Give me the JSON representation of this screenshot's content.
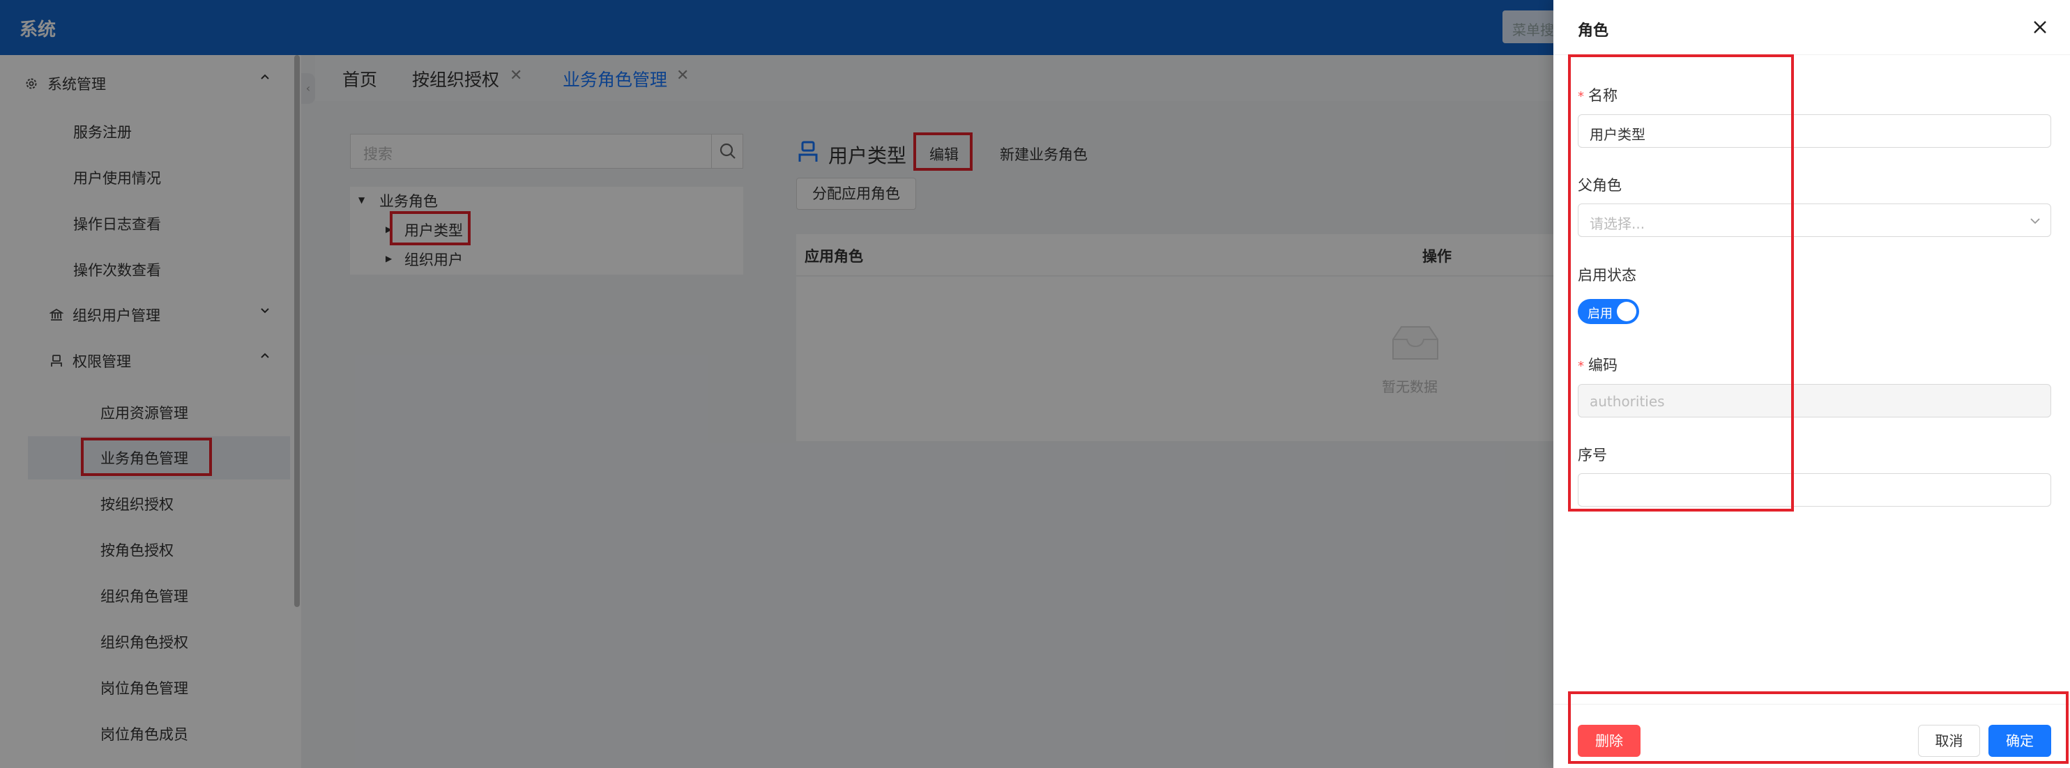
{
  "app": {
    "title": "系统",
    "menu_search_placeholder": "菜单搜"
  },
  "sidebar": {
    "group_system": "系统管理",
    "items_system": [
      "服务注册",
      "用户使用情况",
      "操作日志查看",
      "操作次数查看"
    ],
    "group_org_user": "组织用户管理",
    "group_permission": "权限管理",
    "items_permission": [
      "应用资源管理",
      "业务角色管理",
      "按组织授权",
      "按角色授权",
      "组织角色管理",
      "组织角色授权",
      "岗位角色管理",
      "岗位角色成员"
    ],
    "active_item": "业务角色管理"
  },
  "tabs": [
    {
      "label": "首页",
      "closable": false,
      "active": false
    },
    {
      "label": "按组织授权",
      "closable": true,
      "active": false
    },
    {
      "label": "业务角色管理",
      "closable": true,
      "active": true
    }
  ],
  "tree": {
    "search_placeholder": "搜索",
    "root": "业务角色",
    "children": [
      "用户类型",
      "组织用户"
    ]
  },
  "role_panel": {
    "title": "用户类型",
    "edit_label": "编辑",
    "new_label": "新建业务角色",
    "assign_label": "分配应用角色",
    "columns": [
      "应用角色",
      "操作"
    ],
    "empty_text": "暂无数据"
  },
  "drawer": {
    "title": "角色",
    "name_label": "名称",
    "name_value": "用户类型",
    "parent_label": "父角色",
    "parent_placeholder": "请选择...",
    "status_label": "启用状态",
    "status_toggle_text": "启用",
    "status_enabled": true,
    "code_label": "编码",
    "code_value": "authorities",
    "order_label": "序号",
    "order_value": "",
    "delete_label": "删除",
    "cancel_label": "取消",
    "confirm_label": "确定"
  },
  "colors": {
    "topbar": "#1565c8",
    "primary": "#1677ff",
    "danger": "#ff4d4f",
    "highlight_box": "#e3222b"
  }
}
